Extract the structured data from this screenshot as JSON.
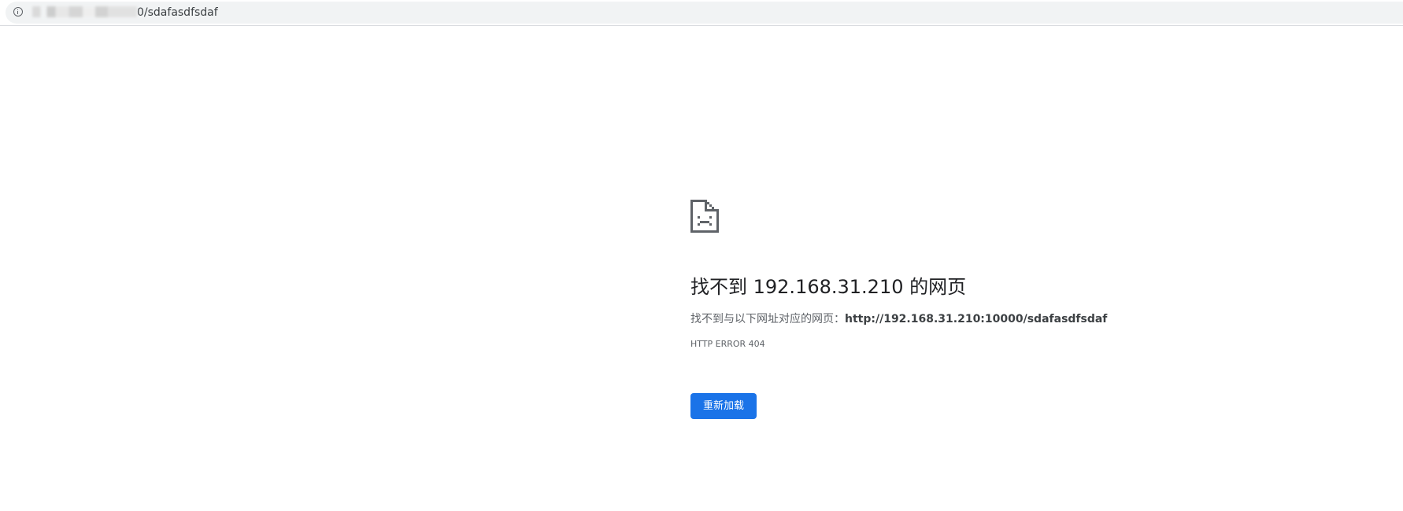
{
  "address_bar": {
    "url_visible": "0/sdafasdfsdaf",
    "icon": "info-icon"
  },
  "error_page": {
    "icon": "sad-page-icon",
    "heading": "找不到 192.168.31.210 的网页",
    "description_prefix": "找不到与以下网址对应的网页：",
    "description_url": "http://192.168.31.210:10000/sdafasdfsdaf",
    "error_code": "HTTP ERROR 404",
    "reload_label": "重新加载"
  },
  "colors": {
    "button_blue": "#1a73e8",
    "heading": "#202124",
    "secondary_text": "#5f6368"
  }
}
